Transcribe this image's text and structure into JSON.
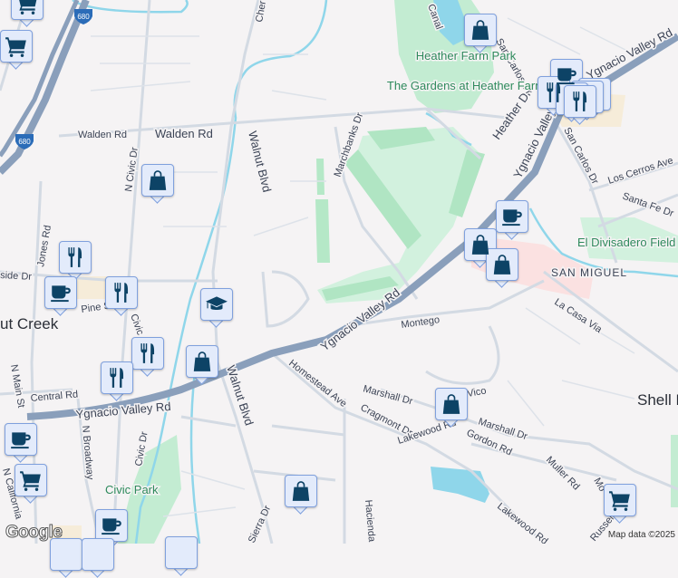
{
  "map": {
    "roads": {
      "walden_rd_1": "Walden Rd",
      "walden_rd_2": "Walden Rd",
      "n_civic_dr": "N Civic Dr",
      "walnut_blvd_n": "Walnut Blvd",
      "walnut_blvd_s": "Walnut Blvd",
      "cherry": "Cher",
      "jones_rd": "Jones Rd",
      "marchbanks_dr": "Marchbanks Dr",
      "heather_dr": "Heather Dr",
      "san_carlos_dr_n": "San Carlos Dr",
      "san_carlos_dr_s": "San Carlos Dr",
      "ygnacio_valley_rd_ne": "Ygnacio Valley Rd",
      "ygnacio_valley_ne2": "Ygnacio Valley",
      "ygnacio_valley_rd_mid": "Ygnacio Valley Rd",
      "ygnacio_valley_rd_w": "Ygnacio Valley Rd",
      "los_cerros_ave": "Los Cerros Ave",
      "santa_fe_dr": "Santa Fe Dr",
      "la_casa_via": "La Casa Via",
      "montego": "Montego",
      "homestead_ave": "Homestead Ave",
      "marshall_dr_1": "Marshall Dr",
      "marshall_dr_2": "Marshall Dr",
      "cragmont_dr": "Cragmont Dr",
      "lakewood_rd_1": "Lakewood Rd",
      "lakewood_rd_2": "Lakewood Rd",
      "gordon_rd": "Gordon Rd",
      "muller_rd": "Muller Rd",
      "hacienda": "Hacienda",
      "central_rd": "Central Rd",
      "n_broadway": "N Broadway",
      "civic_dr": "Civic Dr",
      "civic_dr_n": "Civic",
      "n_main_st": "N Main St",
      "n_california": "N California",
      "pine_st": "Pine St",
      "parkside_dr": "side Dr",
      "sierra_dr": "Sierra Dr",
      "canal": "Canal",
      "russell": "Russell",
      "vico": "Vico",
      "mo": "Mo"
    },
    "highway_shield": "680",
    "places": {
      "heather_farm_park": "Heather Farm Park",
      "gardens": "The Gardens at Heather Farm",
      "el_divisadero": "El Divisadero Field",
      "civic_park": "Civic Park",
      "san_miguel": "SAN MIGUEL",
      "walnut_creek": "ut Creek",
      "shell_ridge": "Shell R"
    },
    "logo": "Google",
    "attribution": "Map data ©2025"
  },
  "colors": {
    "highway": "#8a9fbb",
    "road": "#d0d8e2",
    "park": "#c3ecd2",
    "water": "#8fd6ea",
    "marker_icon": "#0d4366",
    "marker_bg": "#e3ebfb"
  }
}
